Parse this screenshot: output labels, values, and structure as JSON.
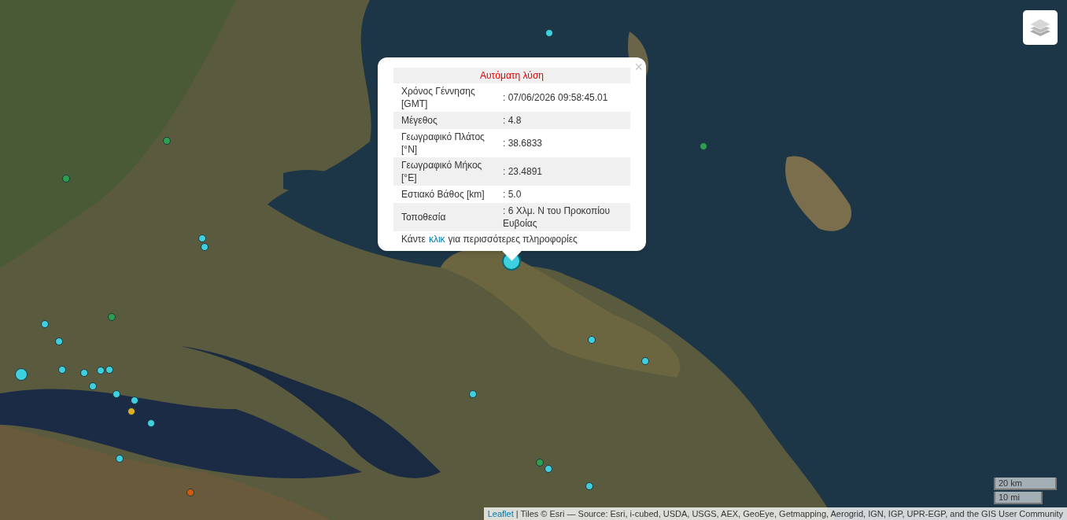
{
  "popup": {
    "close": "×",
    "title": "Αυτόματη λύση",
    "rows": [
      {
        "label": "Χρόνος Γέννησης [GMT]",
        "value": ": 07/06/2026 09:58:45.01"
      },
      {
        "label": "Μέγεθος",
        "value": ": 4.8"
      },
      {
        "label": "Γεωγραφικό Πλάτος [°N]",
        "value": ": 38.6833"
      },
      {
        "label": "Γεωγραφικό Μήκος [°E]",
        "value": ": 23.4891"
      },
      {
        "label": "Εστιακό Βάθος [km]",
        "value": ": 5.0"
      },
      {
        "label": "Τοποθεσία",
        "value": ": 6 Χλμ. N του Προκοπίου Ευβοίας"
      }
    ],
    "footer_before": "Κάντε",
    "footer_link": "κλικ",
    "footer_after": "για περισσότερες πληροφορίες"
  },
  "markers": [
    {
      "kind": "small",
      "color": "#3fd0e0",
      "selected": false
    },
    {
      "kind": "small",
      "color": "#3fd0e0",
      "selected": false
    },
    {
      "kind": "small",
      "color": "#3fd0e0",
      "selected": false
    },
    {
      "kind": "small",
      "color": "#3fd0e0",
      "selected": false
    },
    {
      "kind": "large",
      "color": "#3fd0e0",
      "selected": false
    },
    {
      "kind": "small",
      "color": "#3fd0e0",
      "selected": false
    },
    {
      "kind": "small",
      "color": "#3fd0e0",
      "selected": false
    },
    {
      "kind": "small",
      "color": "#3fd0e0",
      "selected": false
    },
    {
      "kind": "small",
      "color": "#3fd0e0",
      "selected": false
    },
    {
      "kind": "small",
      "color": "#3fd0e0",
      "selected": false
    },
    {
      "kind": "small",
      "color": "#3fd0e0",
      "selected": false
    },
    {
      "kind": "small",
      "color": "#3fd0e0",
      "selected": false
    },
    {
      "kind": "small",
      "color": "#3fd0e0",
      "selected": false
    },
    {
      "kind": "small",
      "color": "#3fd0e0",
      "selected": false
    },
    {
      "kind": "small",
      "color": "#3fd0e0",
      "selected": false
    },
    {
      "kind": "small",
      "color": "#3fd0e0",
      "selected": false
    },
    {
      "kind": "small",
      "color": "#3fd0e0",
      "selected": false
    },
    {
      "kind": "small",
      "color": "#3fd0e0",
      "selected": false
    },
    {
      "kind": "small",
      "color": "#3fd0e0",
      "selected": false
    },
    {
      "kind": "small",
      "color": "#3fd0e0",
      "selected": false
    },
    {
      "kind": "large",
      "color": "#3fd0e0",
      "selected": true
    },
    {
      "kind": "small",
      "color": "#2e9e4f",
      "selected": false
    },
    {
      "kind": "small",
      "color": "#2e9e4f",
      "selected": false
    },
    {
      "kind": "small",
      "color": "#2e9e4f",
      "selected": false
    },
    {
      "kind": "small",
      "color": "#2e9e4f",
      "selected": false
    },
    {
      "kind": "small",
      "color": "#2e9e4f",
      "selected": false
    },
    {
      "kind": "small",
      "color": "#e0b020",
      "selected": false
    },
    {
      "kind": "small",
      "color": "#d45a10",
      "selected": false
    }
  ],
  "scale": [
    "20 km",
    "10 mi"
  ],
  "attribution": {
    "link": "Leaflet",
    "text": "| Tiles © Esri — Source: Esri, i-cubed, USDA, USGS, AEX, GeoEye, Getmapping, Aerogrid, IGN, IGP, UPR-EGP, and the GIS User Community"
  }
}
